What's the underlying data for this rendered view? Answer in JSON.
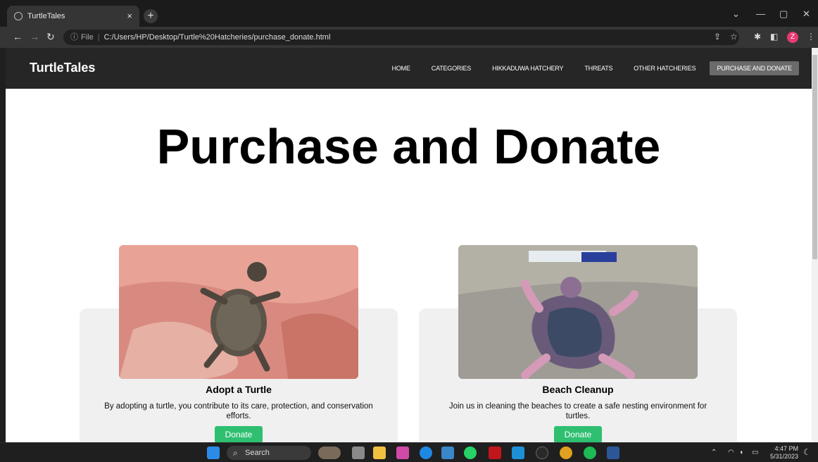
{
  "browser": {
    "tab_title": "TurtleTales",
    "tab_close": "×",
    "new_tab": "+",
    "url_prefix": "File",
    "url": "C:/Users/HP/Desktop/Turtle%20Hatcheries/purchase_donate.html",
    "profile_initial": "Z"
  },
  "site": {
    "brand": "TurtleTales",
    "nav": [
      {
        "label": "HOME"
      },
      {
        "label": "CATEGORIES"
      },
      {
        "label": "HIKKADUWA HATCHERY"
      },
      {
        "label": "THREATS"
      },
      {
        "label": "OTHER HATCHERIES"
      },
      {
        "label": "PURCHASE AND DONATE"
      }
    ],
    "active_nav": "PURCHASE AND DONATE",
    "heading": "Purchase and Donate",
    "cards": [
      {
        "title": "Adopt a Turtle",
        "text": "By adopting a turtle, you contribute to its care, protection, and conservation efforts.",
        "button": "Donate",
        "image": "baby-turtle-in-hand-photo"
      },
      {
        "title": "Beach Cleanup",
        "text": "Join us in cleaning the beaches to create a safe nesting environment for turtles.",
        "button": "Donate",
        "image": "beach-cleanup-aerial-photo"
      }
    ],
    "accent_color": "#2fbf71"
  },
  "taskbar": {
    "search_label": "Search",
    "time": "4:47 PM",
    "date": "5/31/2023"
  }
}
